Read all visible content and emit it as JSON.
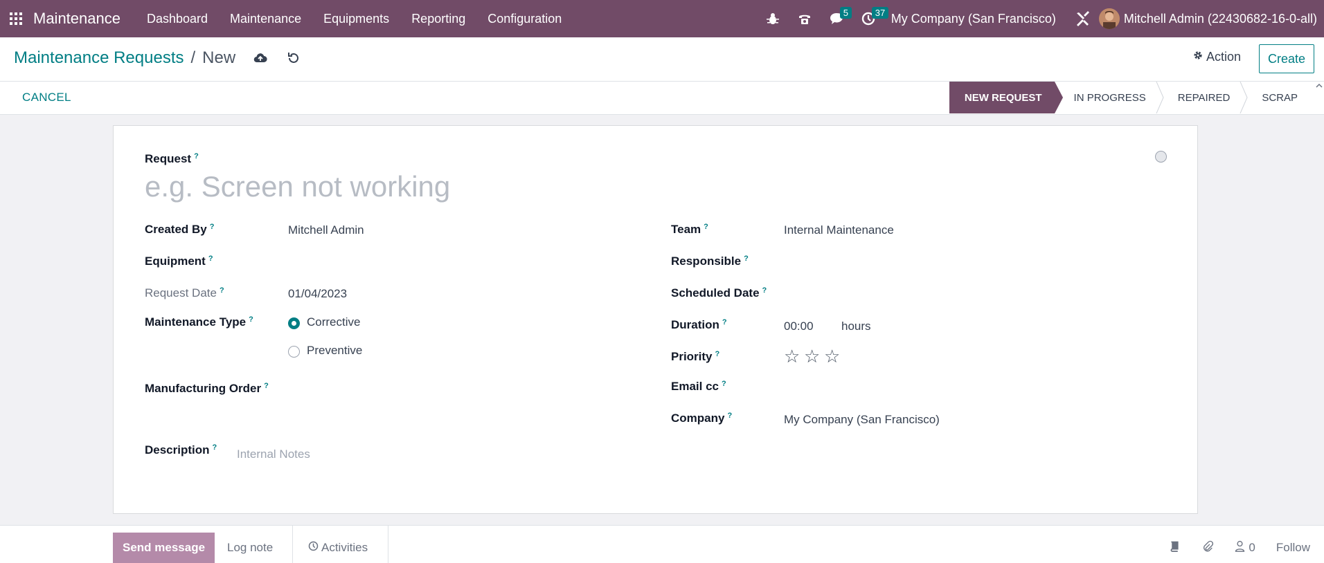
{
  "navbar": {
    "app_name": "Maintenance",
    "menu": [
      "Dashboard",
      "Maintenance",
      "Equipments",
      "Reporting",
      "Configuration"
    ],
    "messages_badge": "5",
    "activities_badge": "37",
    "company": "My Company (San Francisco)",
    "user": "Mitchell Admin (22430682-16-0-all)",
    "icons": [
      "apps-grid-icon",
      "bug-icon",
      "phone-icon",
      "chat-icon",
      "clock-icon",
      "tools-icon"
    ],
    "color": "#714b67"
  },
  "control_panel": {
    "breadcrumb_parent": "Maintenance Requests",
    "breadcrumb_sep": "/",
    "breadcrumb_current": "New",
    "action_label": "Action",
    "create_label": "Create"
  },
  "statusbar": {
    "cancel_label": "CANCEL",
    "stages": [
      "NEW REQUEST",
      "IN PROGRESS",
      "REPAIRED",
      "SCRAP"
    ],
    "active_stage": "NEW REQUEST"
  },
  "form": {
    "request_label": "Request",
    "request_placeholder": "e.g. Screen not working",
    "created_by_label": "Created By",
    "created_by_value": "Mitchell Admin",
    "equipment_label": "Equipment",
    "request_date_label": "Request Date",
    "request_date_value": "01/04/2023",
    "maintenance_type_label": "Maintenance Type",
    "maintenance_type_options": [
      "Corrective",
      "Preventive"
    ],
    "maintenance_type_selected": "Corrective",
    "manufacturing_order_label": "Manufacturing Order",
    "description_label": "Description",
    "description_placeholder": "Internal Notes",
    "team_label": "Team",
    "team_value": "Internal Maintenance",
    "responsible_label": "Responsible",
    "scheduled_date_label": "Scheduled Date",
    "duration_label": "Duration",
    "duration_value": "00:00",
    "duration_unit": "hours",
    "priority_label": "Priority",
    "priority_stars_filled": 0,
    "priority_stars_total": 3,
    "email_cc_label": "Email cc",
    "company_label": "Company",
    "company_value": "My Company (San Francisco)",
    "tooltip_mark": "?"
  },
  "chatter": {
    "send_message_label": "Send message",
    "log_note_label": "Log note",
    "activities_label": "Activities",
    "followers_count": "0",
    "follow_label": "Follow"
  },
  "accent_color": "#017e84"
}
